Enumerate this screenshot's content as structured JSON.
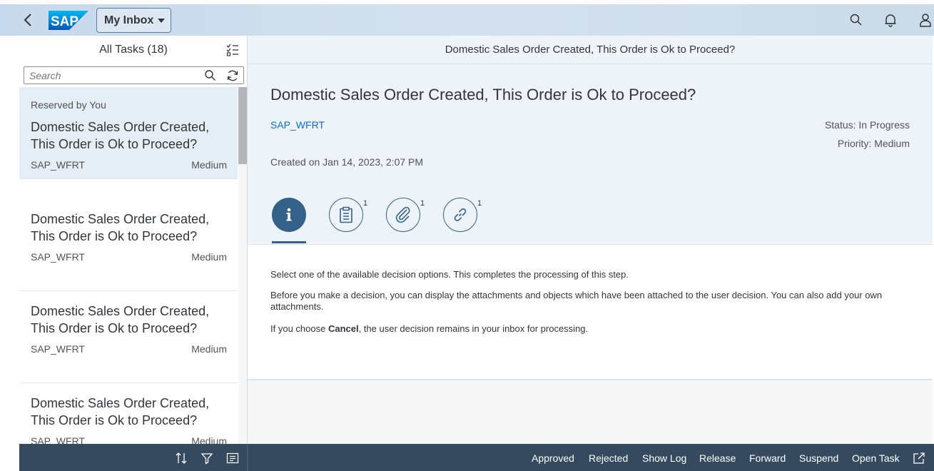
{
  "shell": {
    "logo_text": "SAP",
    "app_title": "My Inbox",
    "back_icon": "chevron-left-icon",
    "icons": [
      "search-icon",
      "bell-icon",
      "user-icon"
    ],
    "brand_color": "#0a6ed1"
  },
  "master": {
    "title": "All Tasks (18)",
    "search_placeholder": "Search",
    "items": [
      {
        "reserved": "Reserved by You",
        "title": "Domestic Sales Order Created, This Order is Ok to Proceed?",
        "user": "SAP_WFRT",
        "priority": "Medium",
        "selected": true
      },
      {
        "title": "Domestic Sales Order Created, This Order is Ok to Proceed?",
        "user": "SAP_WFRT",
        "priority": "Medium"
      },
      {
        "title": "Domestic Sales Order Created, This Order is Ok to Proceed?",
        "user": "SAP_WFRT",
        "priority": "Medium"
      },
      {
        "title": "Domestic Sales Order Created, This Order is Ok to Proceed?",
        "user": "SAP_WFRT",
        "priority": "Medium"
      }
    ],
    "footer_icons": [
      "sort-icon",
      "filter-icon",
      "group-icon"
    ]
  },
  "detail": {
    "header_title": "Domestic Sales Order Created, This Order is Ok to Proceed?",
    "title": "Domestic Sales Order Created, This Order is Ok to Proceed?",
    "user": "SAP_WFRT",
    "created": "Created on Jan 14, 2023, 2:07 PM",
    "status": "Status: In Progress",
    "priority": "Priority: Medium",
    "tabs": [
      {
        "icon": "info-icon",
        "count": ""
      },
      {
        "icon": "notes-icon",
        "count": "1"
      },
      {
        "icon": "attachment-icon",
        "count": "1"
      },
      {
        "icon": "link-icon",
        "count": "1"
      }
    ],
    "description": {
      "p1": "Select one of the available decision options. This completes the processing of this step.",
      "p2": "Before you make a decision, you can display the attachments and objects which have been attached to the user decision. You can also add your own attachments.",
      "p3_prefix": "If you choose ",
      "p3_bold": "Cancel",
      "p3_suffix": ", the user decision remains in your inbox for processing."
    },
    "actions": [
      "Approved",
      "Rejected",
      "Show Log",
      "Release",
      "Forward",
      "Suspend",
      "Open Task"
    ],
    "share_icon": "share-icon"
  }
}
